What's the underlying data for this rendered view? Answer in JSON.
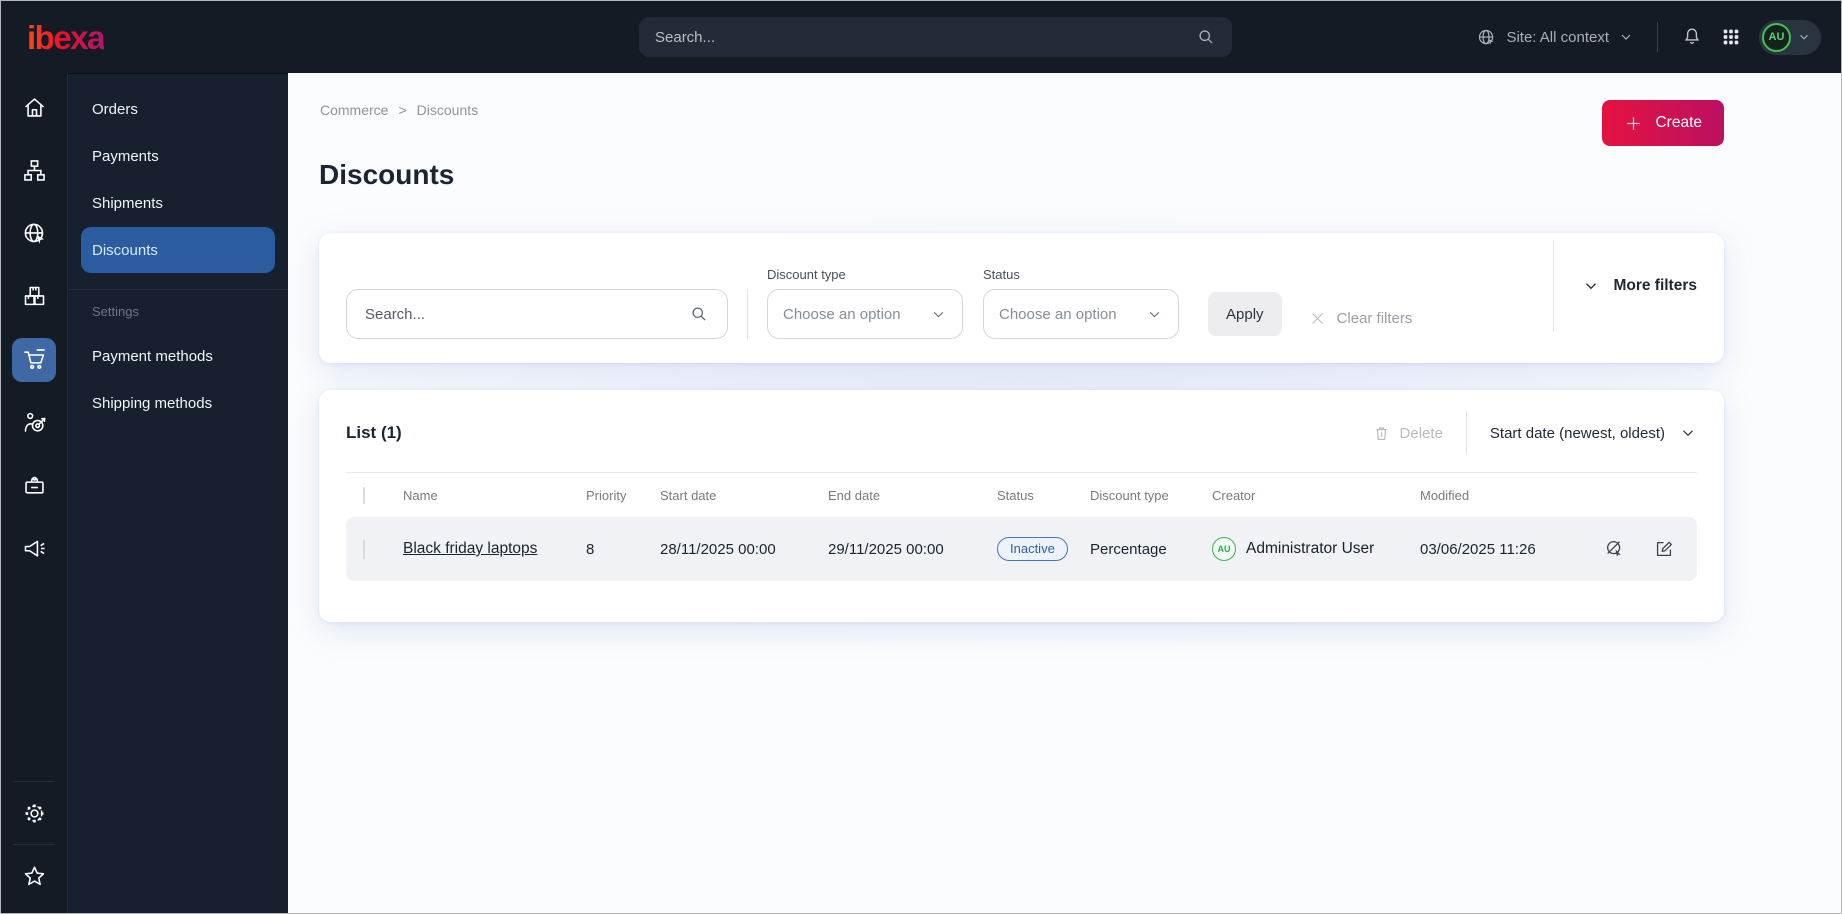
{
  "topbar": {
    "logo_text": "ibexa",
    "search_placeholder": "Search...",
    "site_context_label": "Site: All context",
    "avatar_initials": "AU"
  },
  "icon_rail": {
    "items": [
      {
        "name": "home-icon"
      },
      {
        "name": "content-tree-icon"
      },
      {
        "name": "site-globe-icon"
      },
      {
        "name": "products-boxes-icon"
      },
      {
        "name": "commerce-cart-icon",
        "active": true
      },
      {
        "name": "personalization-target-icon"
      },
      {
        "name": "jobs-bag-icon"
      },
      {
        "name": "campaign-megaphone-icon"
      },
      {
        "name": "settings-gear-icon"
      },
      {
        "name": "bookmarks-star-icon"
      }
    ]
  },
  "side_menu": {
    "items": [
      {
        "label": "Orders"
      },
      {
        "label": "Payments"
      },
      {
        "label": "Shipments"
      },
      {
        "label": "Discounts",
        "active": true
      }
    ],
    "section_label": "Settings",
    "settings_items": [
      {
        "label": "Payment methods"
      },
      {
        "label": "Shipping methods"
      }
    ]
  },
  "breadcrumb": {
    "parent": "Commerce",
    "separator": ">",
    "current": "Discounts"
  },
  "page": {
    "title": "Discounts",
    "create_label": "Create"
  },
  "filters": {
    "search_placeholder": "Search...",
    "discount_type_label": "Discount type",
    "status_label": "Status",
    "dropdown_placeholder": "Choose an option",
    "apply_label": "Apply",
    "clear_label": "Clear filters",
    "more_label": "More filters"
  },
  "list": {
    "title": "List (1)",
    "delete_label": "Delete",
    "sort_label": "Start date (newest, oldest)",
    "columns": [
      "Name",
      "Priority",
      "Start date",
      "End date",
      "Status",
      "Discount type",
      "Creator",
      "Modified"
    ],
    "rows": [
      {
        "name": "Black friday laptops",
        "priority": "8",
        "start_date": "28/11/2025 00:00",
        "end_date": "29/11/2025 00:00",
        "status": "Inactive",
        "discount_type": "Percentage",
        "creator_initials": "AU",
        "creator": "Administrator User",
        "modified": "03/06/2025 11:26"
      }
    ]
  },
  "colors": {
    "brand_gradient_start": "#ff4713",
    "brand_gradient_mid": "#e8112d",
    "brand_gradient_end": "#b0176b",
    "create_gradient_start": "#e41240",
    "create_gradient_end": "#bb1062",
    "topbar_bg": "#141b25",
    "panel_bg": "#16202e",
    "active_menu_blue": "#2a5c9f",
    "active_rail_blue": "#3e69a4",
    "status_inactive_text": "#2d5fab",
    "status_inactive_border": "#4377bc",
    "avatar_green": "#2fae47",
    "row_bg": "#f1f2f5"
  }
}
